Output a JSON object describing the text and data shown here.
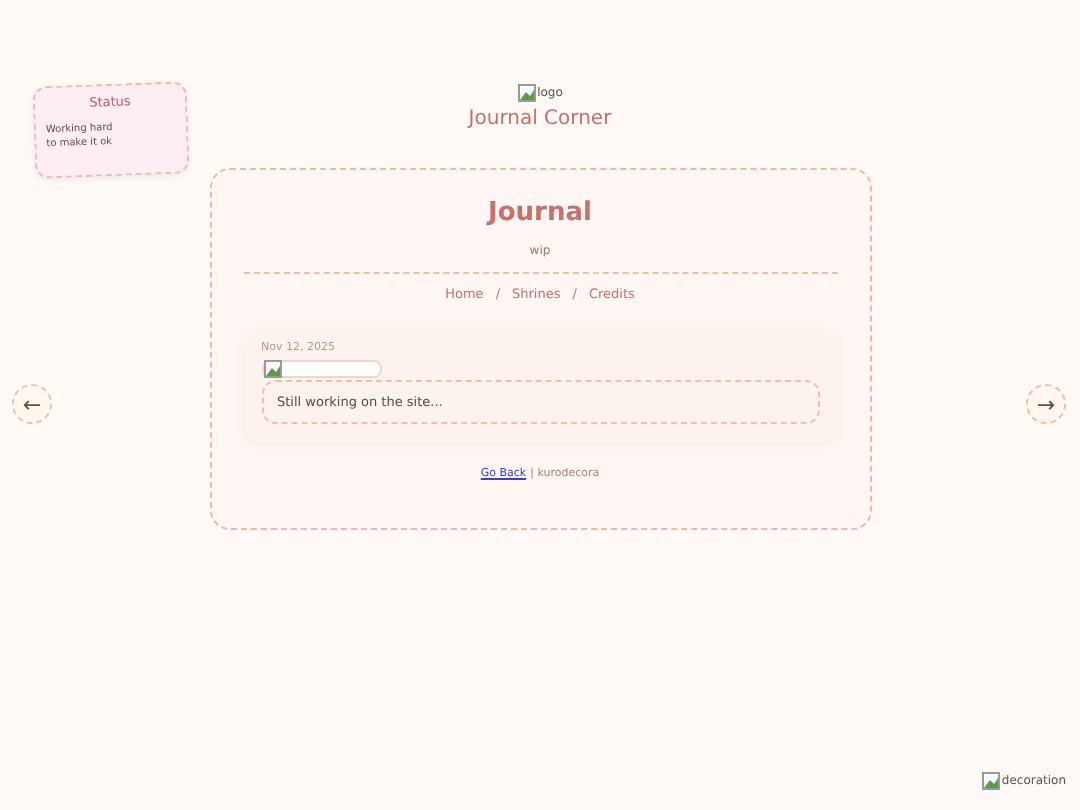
{
  "status_card": {
    "title": "Status",
    "lines": [
      "Working hard",
      "to make it ok"
    ]
  },
  "header": {
    "logo_alt": "logo",
    "site_title": "Journal Corner"
  },
  "nav_arrows": {
    "prev": "←",
    "next": "→"
  },
  "journal": {
    "title": "Journal",
    "subtitle": "wip",
    "nav": [
      {
        "label": "Home"
      },
      {
        "label": "Shrines"
      },
      {
        "label": "Credits"
      }
    ],
    "separator": "/",
    "entries": [
      {
        "date": "Nov 12, 2025",
        "text": "Still working on the site..."
      }
    ],
    "footer": {
      "link": "Go Back",
      "text": "| kurodecora"
    }
  },
  "decoration_alt": "decoration"
}
